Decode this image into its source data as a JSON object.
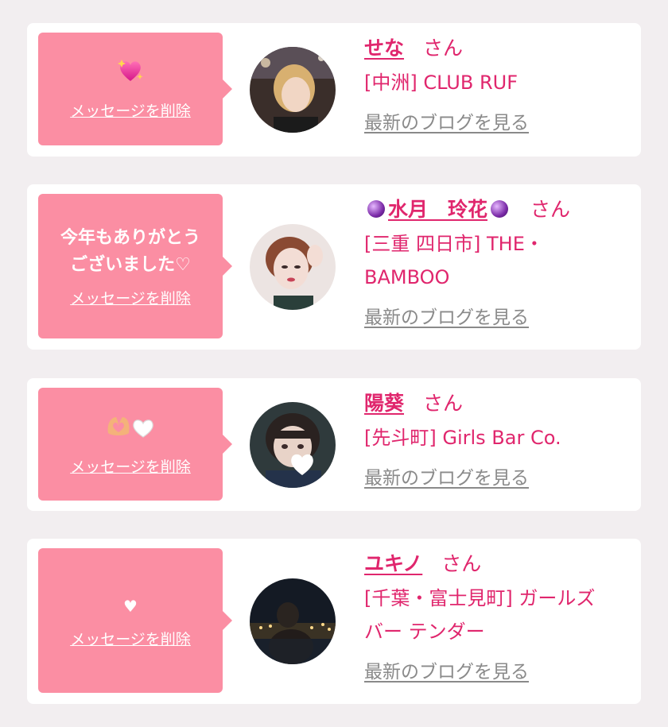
{
  "delete_label": "メッセージを削除",
  "blog_label": "最新のブログを見る",
  "honorific": "さん",
  "cards": [
    {
      "message": "",
      "message_icon": "sparkling-heart-emoji",
      "name": "せな",
      "shop": "[中洲] CLUB RUF"
    },
    {
      "message": "今年もありがとう\nございました♡",
      "message_icon": "",
      "name": "水月　玲花",
      "shop": "[三重 四日市] THE・\nBAMBOO"
    },
    {
      "message": "",
      "message_icon": "heart-hands-and-white-heart-emoji",
      "name": "陽葵",
      "shop": "[先斗町] Girls Bar Co."
    },
    {
      "message": "♥",
      "message_icon": "",
      "name": "ユキノ",
      "shop": "[千葉・富士見町] ガールズ\nバー テンダー"
    }
  ],
  "colors": {
    "bubble": "#fb8ea3",
    "accent": "#e0266d",
    "link_gray": "#8a8a8a",
    "background": "#f2eef0"
  }
}
